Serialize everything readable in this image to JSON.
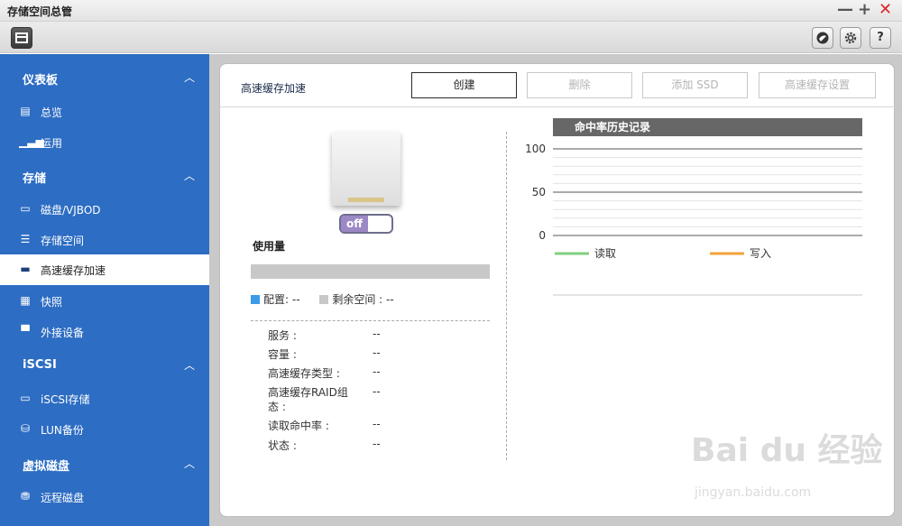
{
  "app": {
    "title": "存储空间总管"
  },
  "window_controls": {
    "minimize": "—",
    "maximize": "+",
    "close": "✕"
  },
  "toolbar": {
    "help_label": "?"
  },
  "sidebar": {
    "sections": [
      {
        "label": "仪表板",
        "items": [
          {
            "label": "总览",
            "icon": "overview-icon"
          },
          {
            "label": "运用",
            "icon": "chart-icon"
          }
        ]
      },
      {
        "label": "存储",
        "items": [
          {
            "label": "磁盘/VJBOD",
            "icon": "disk-icon"
          },
          {
            "label": "存储空间",
            "icon": "storage-icon"
          },
          {
            "label": "高速缓存加速",
            "icon": "cache-icon",
            "active": true
          },
          {
            "label": "快照",
            "icon": "snapshot-icon"
          },
          {
            "label": "外接设备",
            "icon": "external-device-icon"
          }
        ]
      },
      {
        "label": "iSCSI",
        "items": [
          {
            "label": "iSCSI存储",
            "icon": "iscsi-storage-icon"
          },
          {
            "label": "LUN备份",
            "icon": "lun-backup-icon"
          }
        ]
      },
      {
        "label": "虚拟磁盘",
        "items": [
          {
            "label": "远程磁盘",
            "icon": "remote-disk-icon"
          }
        ]
      }
    ]
  },
  "panel": {
    "title": "高速缓存加速",
    "buttons": {
      "create": "创建",
      "delete": "删除",
      "add_ssd": "添加 SSD",
      "cache_settings": "高速缓存设置"
    },
    "toggle": {
      "state": "off"
    },
    "usage": {
      "label": "使用量",
      "configured_label": "配置: --",
      "remaining_label": "剩余空间 : --",
      "configured_color": "#3c9be8",
      "remaining_color": "#c8c8c8"
    },
    "info": [
      {
        "key": "服务 :",
        "value": "--"
      },
      {
        "key": "容量 :",
        "value": "--"
      },
      {
        "key": "高速缓存类型 :",
        "value": "--"
      },
      {
        "key": "高速缓存RAID组态 :",
        "value": "--"
      },
      {
        "key": "读取命中率 :",
        "value": "--"
      },
      {
        "key": "状态 :",
        "value": "--"
      }
    ]
  },
  "chart_data": {
    "type": "line",
    "title": "命中率历史记录",
    "ylim": [
      0,
      100
    ],
    "yticks": [
      "100",
      "50",
      "0"
    ],
    "series": [
      {
        "name": "读取",
        "color": "#7fcf7f",
        "values": []
      },
      {
        "name": "写入",
        "color": "#f2a33a",
        "values": []
      }
    ]
  },
  "watermark": {
    "brand": "Bai du 经验",
    "url": "jingyan.baidu.com"
  }
}
